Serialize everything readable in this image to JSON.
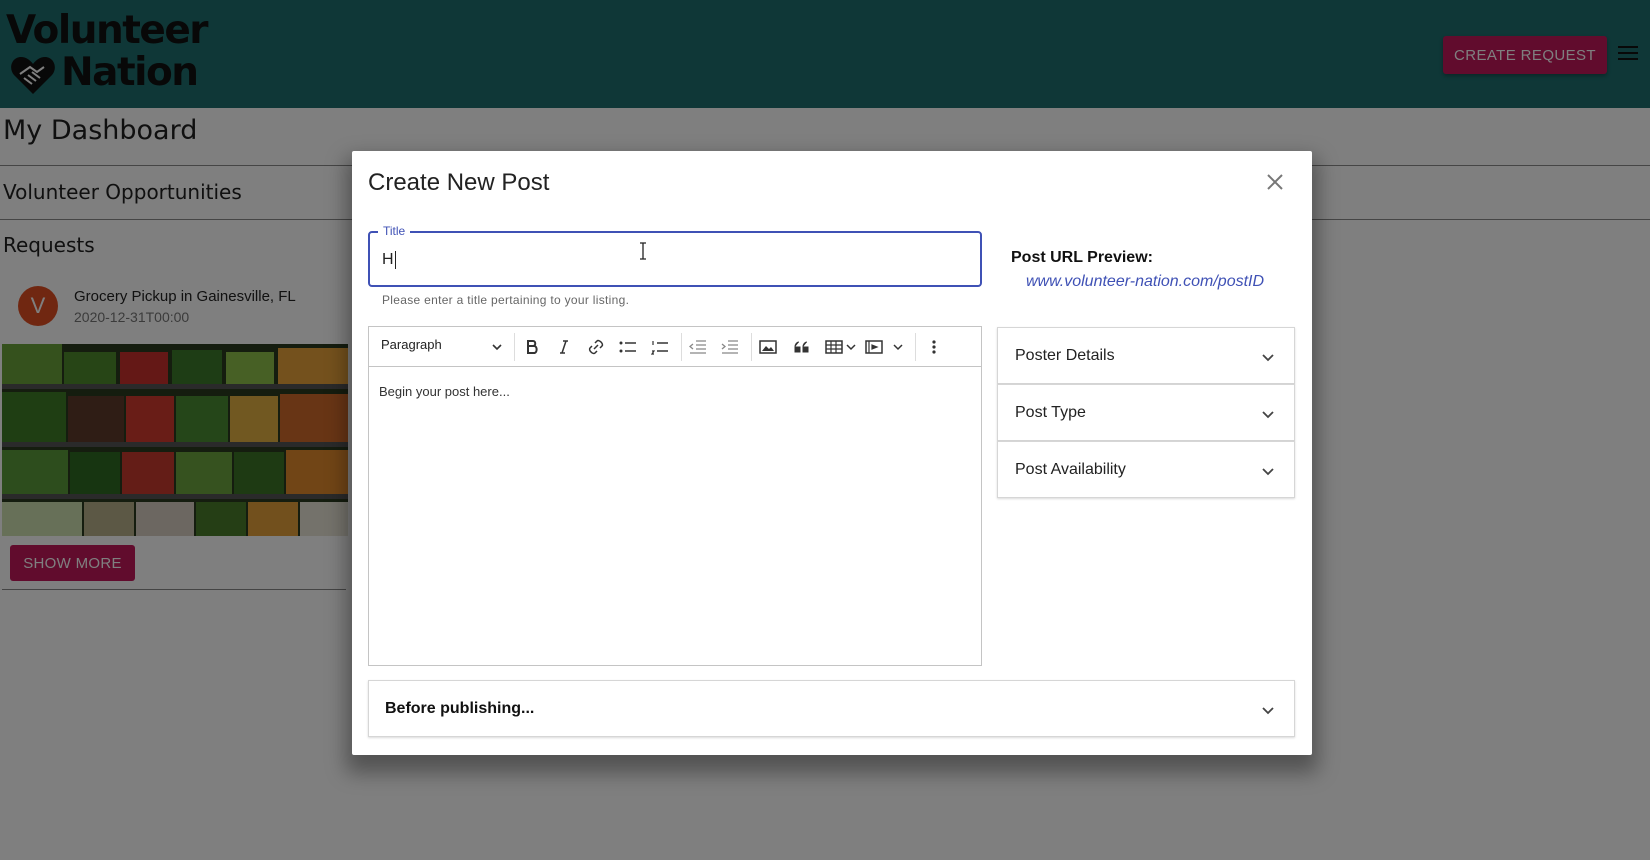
{
  "brand": {
    "line1": "Volunteer",
    "line2": "Nation",
    "color": "#1e6f6f"
  },
  "header": {
    "create_request_label": "CREATE REQUEST",
    "menu_icon": "hamburger-menu-icon",
    "accent_color": "#c2185b"
  },
  "dashboard": {
    "title": "My Dashboard",
    "opportunities_title": "Volunteer Opportunities",
    "requests_title": "Requests",
    "request_card": {
      "avatar_letter": "V",
      "title": "Grocery Pickup in Gainesville, FL",
      "date": "2020-12-31T00:00",
      "image": "grocery-produce-shelves-image",
      "show_more_label": "SHOW MORE"
    }
  },
  "modal": {
    "title": "Create New Post",
    "close_icon": "close-icon",
    "title_field": {
      "label": "Title",
      "value": "H",
      "helper": "Please enter a title pertaining to your listing."
    },
    "url_preview": {
      "label": "Post URL Preview:",
      "value": "www.volunteer-nation.com/postID"
    },
    "editor": {
      "block_format": "Paragraph",
      "toolbar_icons": [
        "bold-icon",
        "italic-icon",
        "link-icon",
        "bulleted-list-icon",
        "numbered-list-icon",
        "outdent-icon",
        "indent-icon",
        "image-icon",
        "blockquote-icon",
        "table-icon",
        "media-embed-icon",
        "more-options-icon"
      ],
      "placeholder": "Begin your post here..."
    },
    "accordions": [
      {
        "label": "Poster Details"
      },
      {
        "label": "Post Type"
      },
      {
        "label": "Post Availability"
      }
    ],
    "publish_accordion": {
      "label": "Before publishing..."
    }
  }
}
